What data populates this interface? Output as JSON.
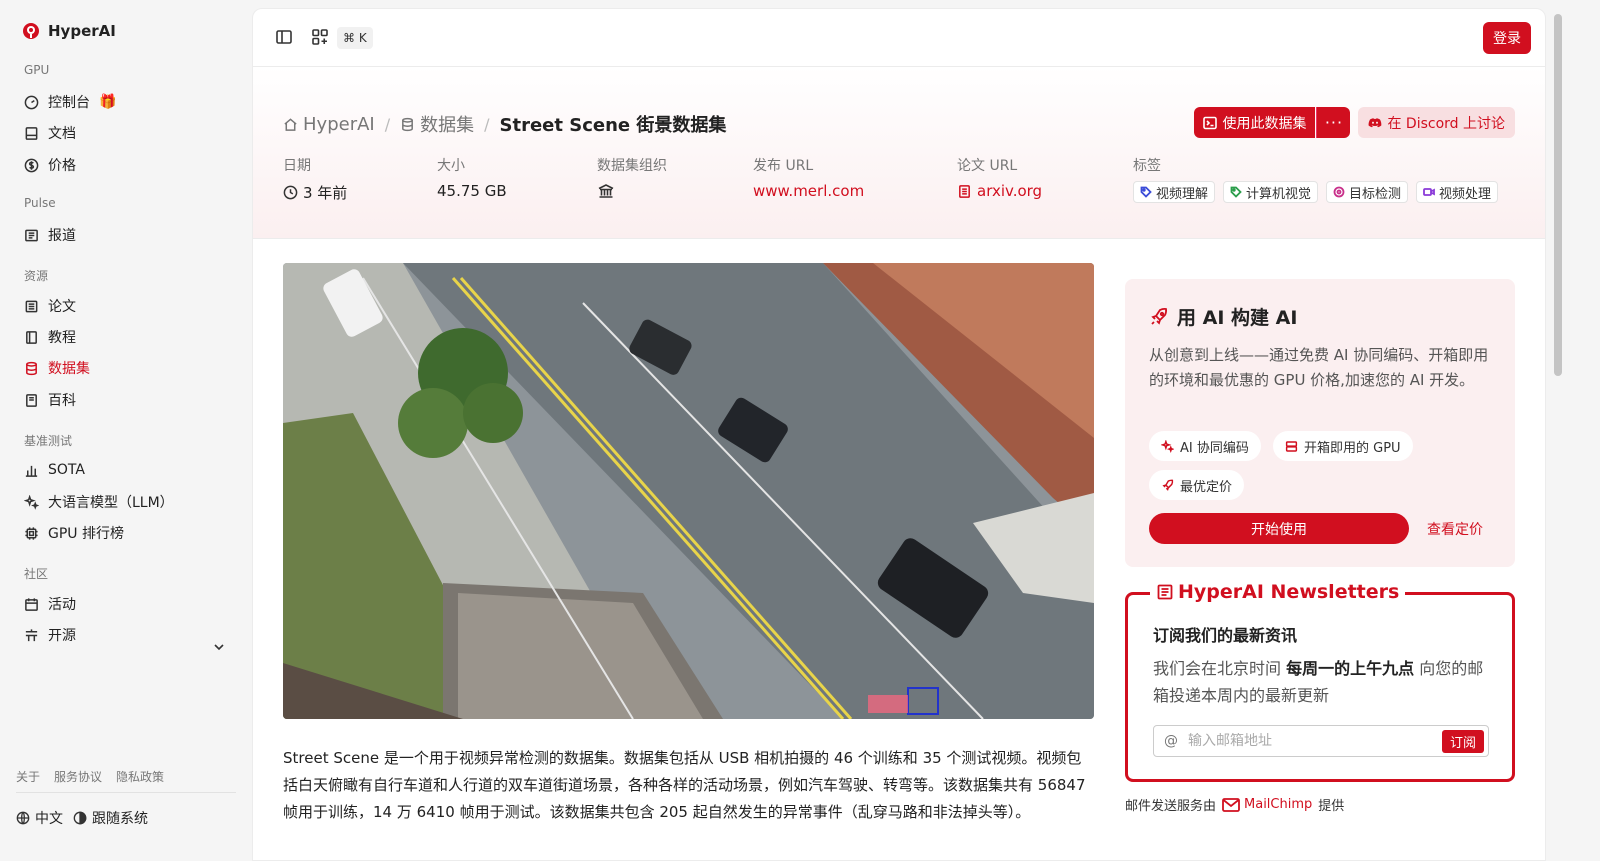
{
  "brand": {
    "name": "HyperAI"
  },
  "sidebar": {
    "sections": {
      "gpu": "GPU",
      "pulse": "Pulse",
      "resources": "资源",
      "benchmark": "基准测试",
      "community": "社区"
    },
    "items": {
      "console": "控制台",
      "docs": "文档",
      "pricing": "价格",
      "news": "报道",
      "papers": "论文",
      "tutorials": "教程",
      "datasets": "数据集",
      "wiki": "百科",
      "sota": "SOTA",
      "llm": "大语言模型（LLM）",
      "gpu_rank": "GPU 排行榜",
      "events": "活动",
      "opensource": "开源"
    },
    "footer": {
      "about": "关于",
      "terms": "服务协议",
      "privacy": "隐私政策",
      "language": "中文",
      "theme": "跟随系统"
    }
  },
  "topbar": {
    "shortcut": "⌘ K",
    "login": "登录"
  },
  "breadcrumb": {
    "home": "HyperAI",
    "section": "数据集",
    "current": "Street Scene 街景数据集"
  },
  "actions": {
    "use_dataset": "使用此数据集",
    "more": "···",
    "discord": "在 Discord 上讨论"
  },
  "meta": {
    "date_label": "日期",
    "date_value": "3 年前",
    "size_label": "大小",
    "size_value": "45.75 GB",
    "org_label": "数据集组织",
    "release_label": "发布 URL",
    "release_value": "www.merl.com",
    "paper_label": "论文 URL",
    "paper_value": "arxiv.org",
    "tags_label": "标签",
    "tags": [
      "视频理解",
      "计算机视觉",
      "目标检测",
      "视频处理"
    ]
  },
  "description": "Street Scene 是一个用于视频异常检测的数据集。数据集包括从 USB 相机拍摄的 46 个训练和 35 个测试视频。视频包括白天俯瞰有自行车道和人行道的双车道街道场景，各种各样的活动场景，例如汽车驾驶、转弯等。该数据集共有 56847 帧用于训练，14 万 6410 帧用于测试。该数据集共包含 205 起自然发生的异常事件（乱穿马路和非法掉头等）。",
  "ai_card": {
    "title": "用 AI 构建 AI",
    "desc": "从创意到上线——通过免费 AI 协同编码、开箱即用的环境和最优惠的 GPU 价格,加速您的 AI 开发。",
    "chip1": "AI 协同编码",
    "chip2": "开箱即用的 GPU",
    "chip3": "最优定价",
    "start": "开始使用",
    "pricing": "查看定价"
  },
  "newsletter": {
    "title": "HyperAI Newsletters",
    "heading": "订阅我们的最新资讯",
    "text_pre": "我们会在北京时间 ",
    "text_bold": "每周一的上午九点",
    "text_post": " 向您的邮箱投递本周内的最新更新",
    "placeholder": "输入邮箱地址",
    "subscribe": "订阅",
    "note_pre": "邮件发送服务由",
    "note_brand": "MailChimp",
    "note_post": "提供"
  },
  "colors": {
    "accent": "#d10f1f"
  }
}
